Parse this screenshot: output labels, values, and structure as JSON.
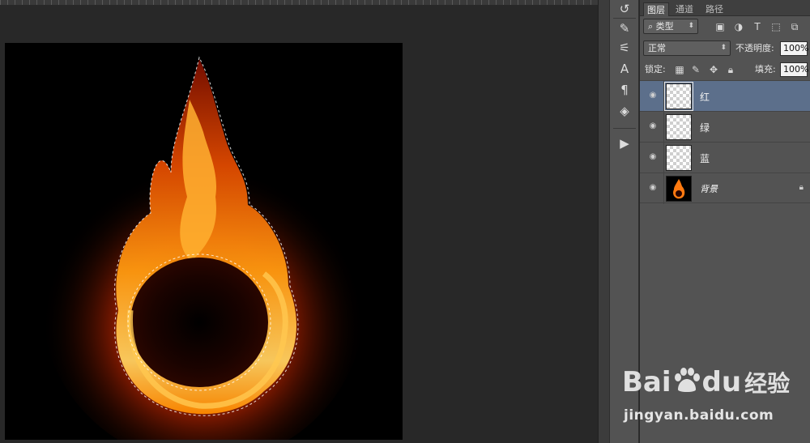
{
  "panel": {
    "tabs": [
      {
        "label": "图层"
      },
      {
        "label": "通道"
      },
      {
        "label": "路径"
      }
    ],
    "filter_type": "类型",
    "blend_mode": "正常",
    "opacity_label": "不透明度:",
    "opacity_value": "100%",
    "lock_label": "锁定:",
    "fill_label": "填充:",
    "fill_value": "100%",
    "layers": [
      {
        "name": "红",
        "selected": true
      },
      {
        "name": "绿",
        "selected": false
      },
      {
        "name": "蓝",
        "selected": false
      },
      {
        "name": "背景",
        "selected": false,
        "locked": true
      }
    ]
  },
  "watermark": {
    "brand_left": "Bai",
    "brand_right": "du",
    "jingyan": "经验",
    "url": "jingyan.baidu.com"
  },
  "icons": [
    "tool-history-icon",
    "brush-preset-icon",
    "adjust-icon",
    "character-icon",
    "paragraph-icon",
    "3d-icon",
    "play-icon",
    "eye-icon",
    "lock-icon"
  ],
  "colors": {
    "selected_layer": "#5c6f8b",
    "panel": "#535353",
    "workspace": "#282828"
  }
}
